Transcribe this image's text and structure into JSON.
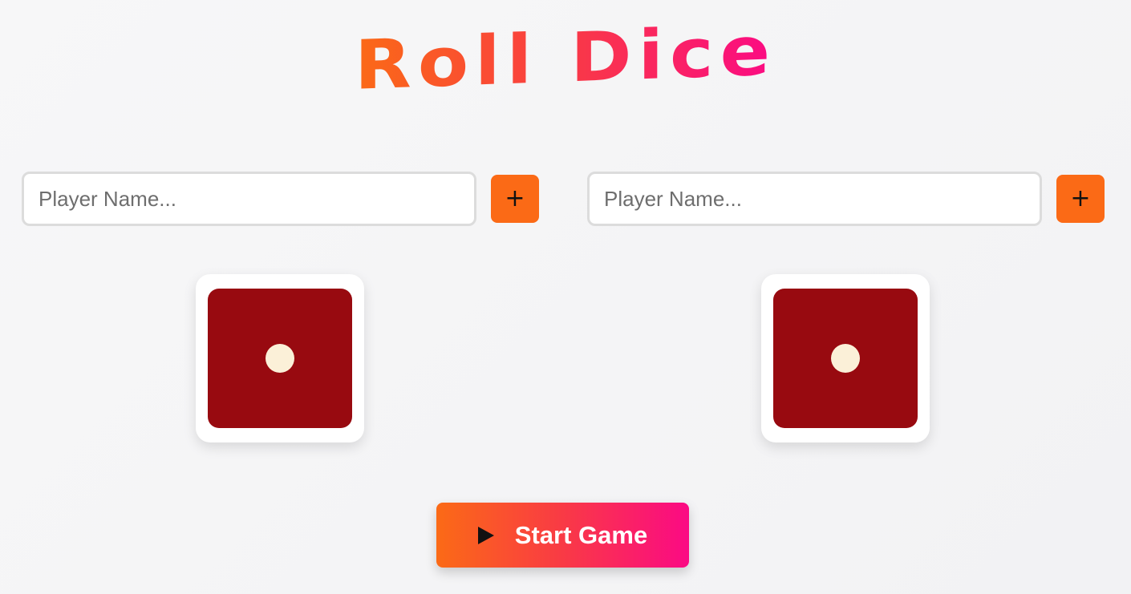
{
  "title": "Roll Dice",
  "players": [
    {
      "placeholder": "Player Name...",
      "value": "",
      "add_label": "+",
      "die_value": 1
    },
    {
      "placeholder": "Player Name...",
      "value": "",
      "add_label": "+",
      "die_value": 1
    }
  ],
  "start_button": {
    "label": "Start Game",
    "icon": "play-icon"
  },
  "colors": {
    "accent_orange": "#fb6a16",
    "accent_pink": "#fb0a84",
    "die_face": "#980a10",
    "pip": "#fbf0d8"
  }
}
